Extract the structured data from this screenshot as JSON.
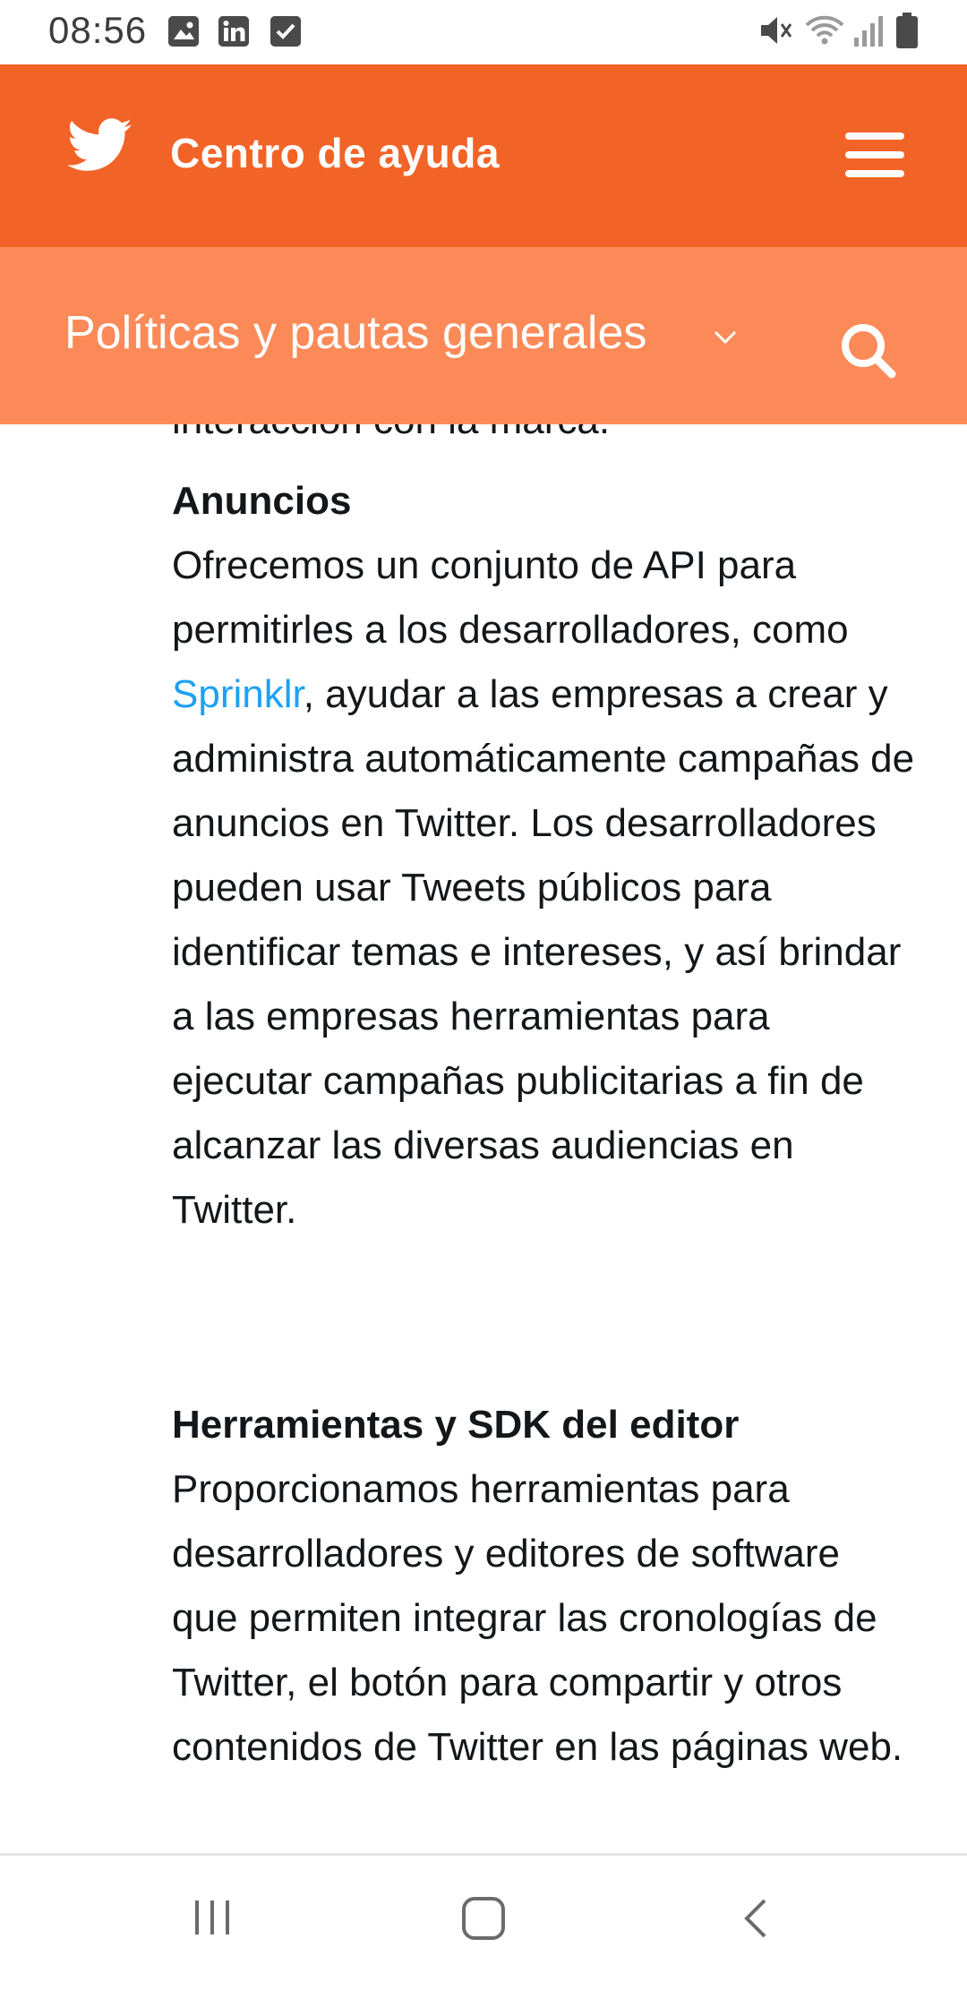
{
  "status_bar": {
    "time": "08:56",
    "left_icons": [
      "image-icon",
      "linkedin-icon",
      "checkbox-icon"
    ],
    "right_icons": [
      "mute-icon",
      "wifi-icon",
      "signal-icon",
      "battery-icon"
    ]
  },
  "header": {
    "title": "Centro de ayuda",
    "logo": "twitter-bird-icon",
    "menu": "hamburger-menu-icon",
    "color": "#f26327"
  },
  "subheader": {
    "section_label": "Políticas y pautas generales",
    "dropdown_icon": "chevron-down-icon",
    "search_icon": "search-icon",
    "color": "#fb8a58"
  },
  "content": {
    "cut_text": "interacción con la marca.",
    "sections": [
      {
        "heading": "Anuncios",
        "text_before_link": "Ofrecemos un conjunto de API para permitirles a los desarrolladores, como ",
        "link": "Sprinklr",
        "text_after_link": ", ayudar a las empresas a crear y administra automáticamente campañas de anuncios en Twitter. Los desarrolladores pueden usar Tweets públicos para identificar temas e intereses, y así brindar a las empresas herramientas para ejecutar campañas publicitarias a fin de alcanzar las diversas audiencias en Twitter."
      },
      {
        "heading": "Herramientas y SDK del editor",
        "text": "Proporcionamos herramientas para desarrolladores y editores de software que permiten integrar las cronologías de Twitter, el botón para compartir y otros contenidos de Twitter en las páginas web."
      }
    ],
    "link_color": "#1da1f2"
  },
  "nav_bar": {
    "buttons": [
      "recent-apps-icon",
      "home-icon",
      "back-icon"
    ]
  }
}
